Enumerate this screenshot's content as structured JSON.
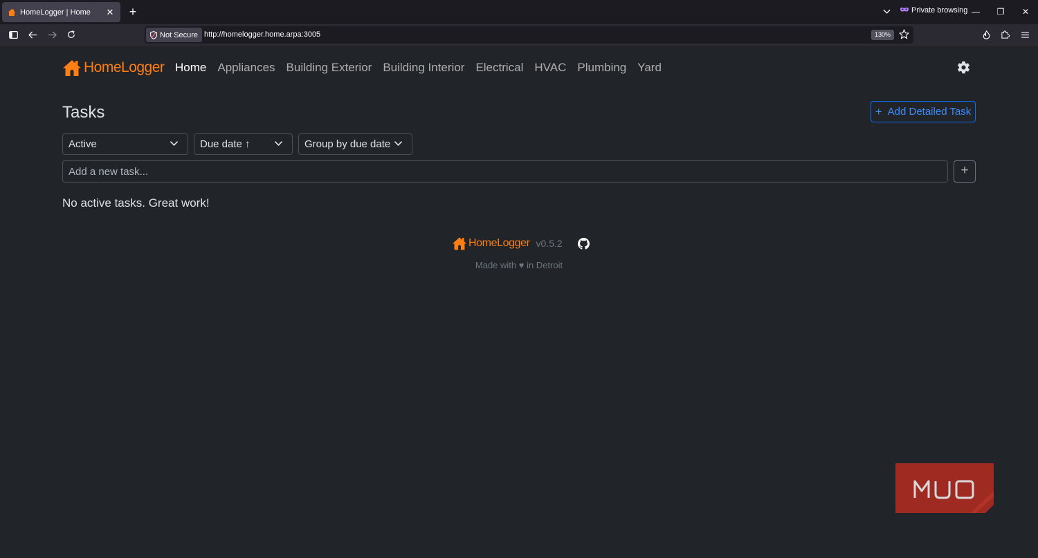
{
  "browser": {
    "tab_title": "HomeLogger | Home",
    "tab_close": "✕",
    "new_tab": "+",
    "private_label": "Private browsing",
    "window_minimize": "—",
    "window_restore": "❐",
    "window_close": "✕",
    "not_secure_label": "Not Secure",
    "url": "http://homelogger.home.arpa:3005",
    "zoom": "130%"
  },
  "app": {
    "brand": "HomeLogger",
    "accent_color": "#fd7e14",
    "nav": [
      {
        "label": "Home",
        "active": true
      },
      {
        "label": "Appliances"
      },
      {
        "label": "Building Exterior"
      },
      {
        "label": "Building Interior"
      },
      {
        "label": "Electrical"
      },
      {
        "label": "HVAC"
      },
      {
        "label": "Plumbing"
      },
      {
        "label": "Yard"
      }
    ]
  },
  "tasks": {
    "title": "Tasks",
    "add_detailed_label": "Add Detailed Task",
    "add_detailed_icon": "+",
    "filters": {
      "status": "Active",
      "sort": "Due date ↑",
      "group": "Group by due date"
    },
    "new_task_placeholder": "Add a new task...",
    "add_button": "+",
    "empty_message": "No active tasks. Great work!"
  },
  "footer": {
    "brand": "HomeLogger",
    "version": "v0.5.2",
    "made_with": "Made with ♥ in Detroit"
  },
  "watermark": {
    "text": "MUO",
    "color": "#9f2a22"
  }
}
